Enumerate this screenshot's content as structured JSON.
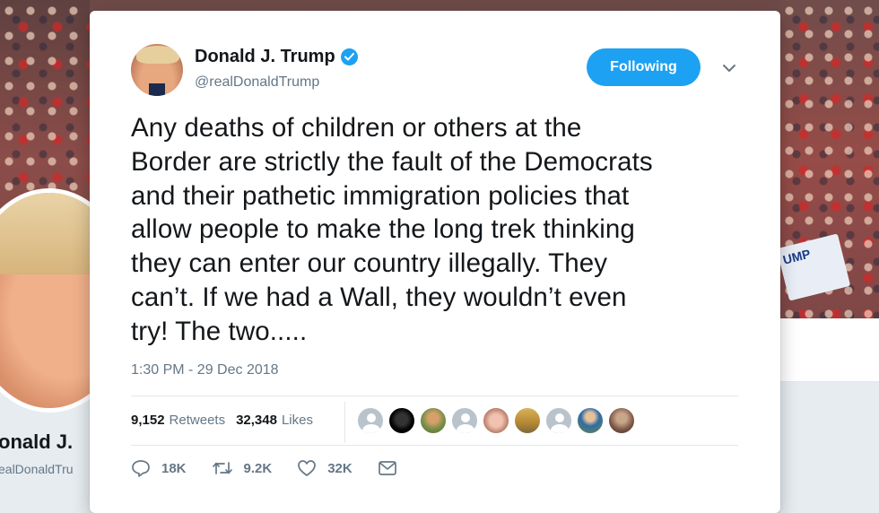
{
  "background": {
    "profile_name": "onald J.",
    "profile_handle": "ealDonaldTru",
    "sign_text": "UMP"
  },
  "tweet": {
    "author_name": "Donald J. Trump",
    "author_handle": "@realDonaldTrump",
    "verified": true,
    "follow_button_label": "Following",
    "text": "Any deaths of children or others at the\nBorder are strictly the fault of the Democrats\nand their pathetic immigration policies that\nallow people to make the long trek thinking\nthey can enter our country illegally. They\ncan’t. If we had a Wall, they wouldn’t even\ntry! The two.....",
    "timestamp": "1:30 PM - 29 Dec 2018",
    "retweets_count": "9,152",
    "retweets_label": "Retweets",
    "likes_count": "32,348",
    "likes_label": "Likes",
    "likers": [
      {
        "icon": "default-avatar-icon"
      },
      {
        "icon": "user-avatar-dark"
      },
      {
        "icon": "user-avatar-green"
      },
      {
        "icon": "default-avatar-icon"
      },
      {
        "icon": "user-avatar-face"
      },
      {
        "icon": "user-avatar-landscape"
      },
      {
        "icon": "default-avatar-icon"
      },
      {
        "icon": "user-avatar-outdoor"
      },
      {
        "icon": "user-avatar-brown"
      }
    ],
    "actions": {
      "replies": "18K",
      "retweets": "9.2K",
      "likes": "32K"
    }
  },
  "colors": {
    "accent": "#1da1f2",
    "text": "#14171a",
    "muted": "#657786",
    "border": "#e1e8ed"
  }
}
